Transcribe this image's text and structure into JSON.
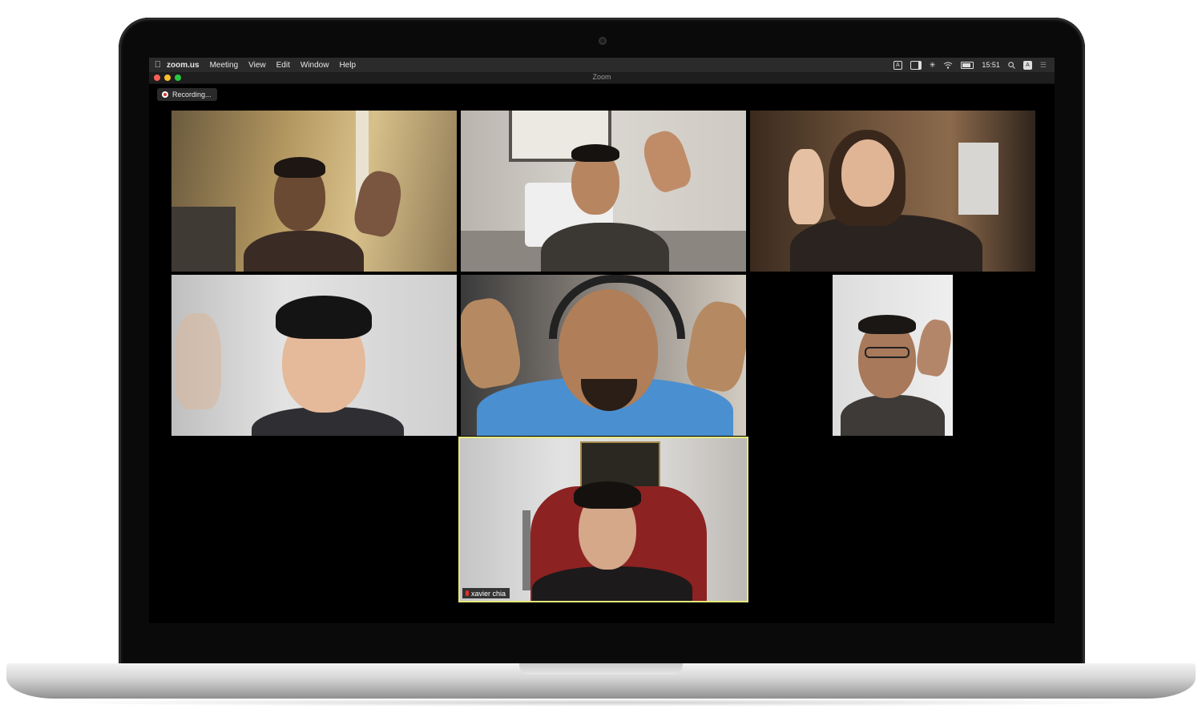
{
  "menubar": {
    "app": "zoom.us",
    "items": [
      "Meeting",
      "View",
      "Edit",
      "Window",
      "Help"
    ],
    "clock": "15:51",
    "status_icons": [
      "a-icon",
      "sidebar-icon",
      "bluetooth-icon",
      "wifi-icon",
      "battery-icon",
      "search-icon",
      "user-icon",
      "list-icon"
    ]
  },
  "window": {
    "title": "Zoom",
    "recording_label": "Recording..."
  },
  "participants": [
    {
      "id": "p1",
      "name": ""
    },
    {
      "id": "p2",
      "name": ""
    },
    {
      "id": "p3",
      "name": ""
    },
    {
      "id": "p4",
      "name": ""
    },
    {
      "id": "p5",
      "name": ""
    },
    {
      "id": "p6",
      "name": ""
    },
    {
      "id": "p7",
      "name": "xavier chia",
      "active_speaker": true
    }
  ],
  "colors": {
    "active_speaker_border": "#e6e87a",
    "recording_red": "#e0312b"
  }
}
